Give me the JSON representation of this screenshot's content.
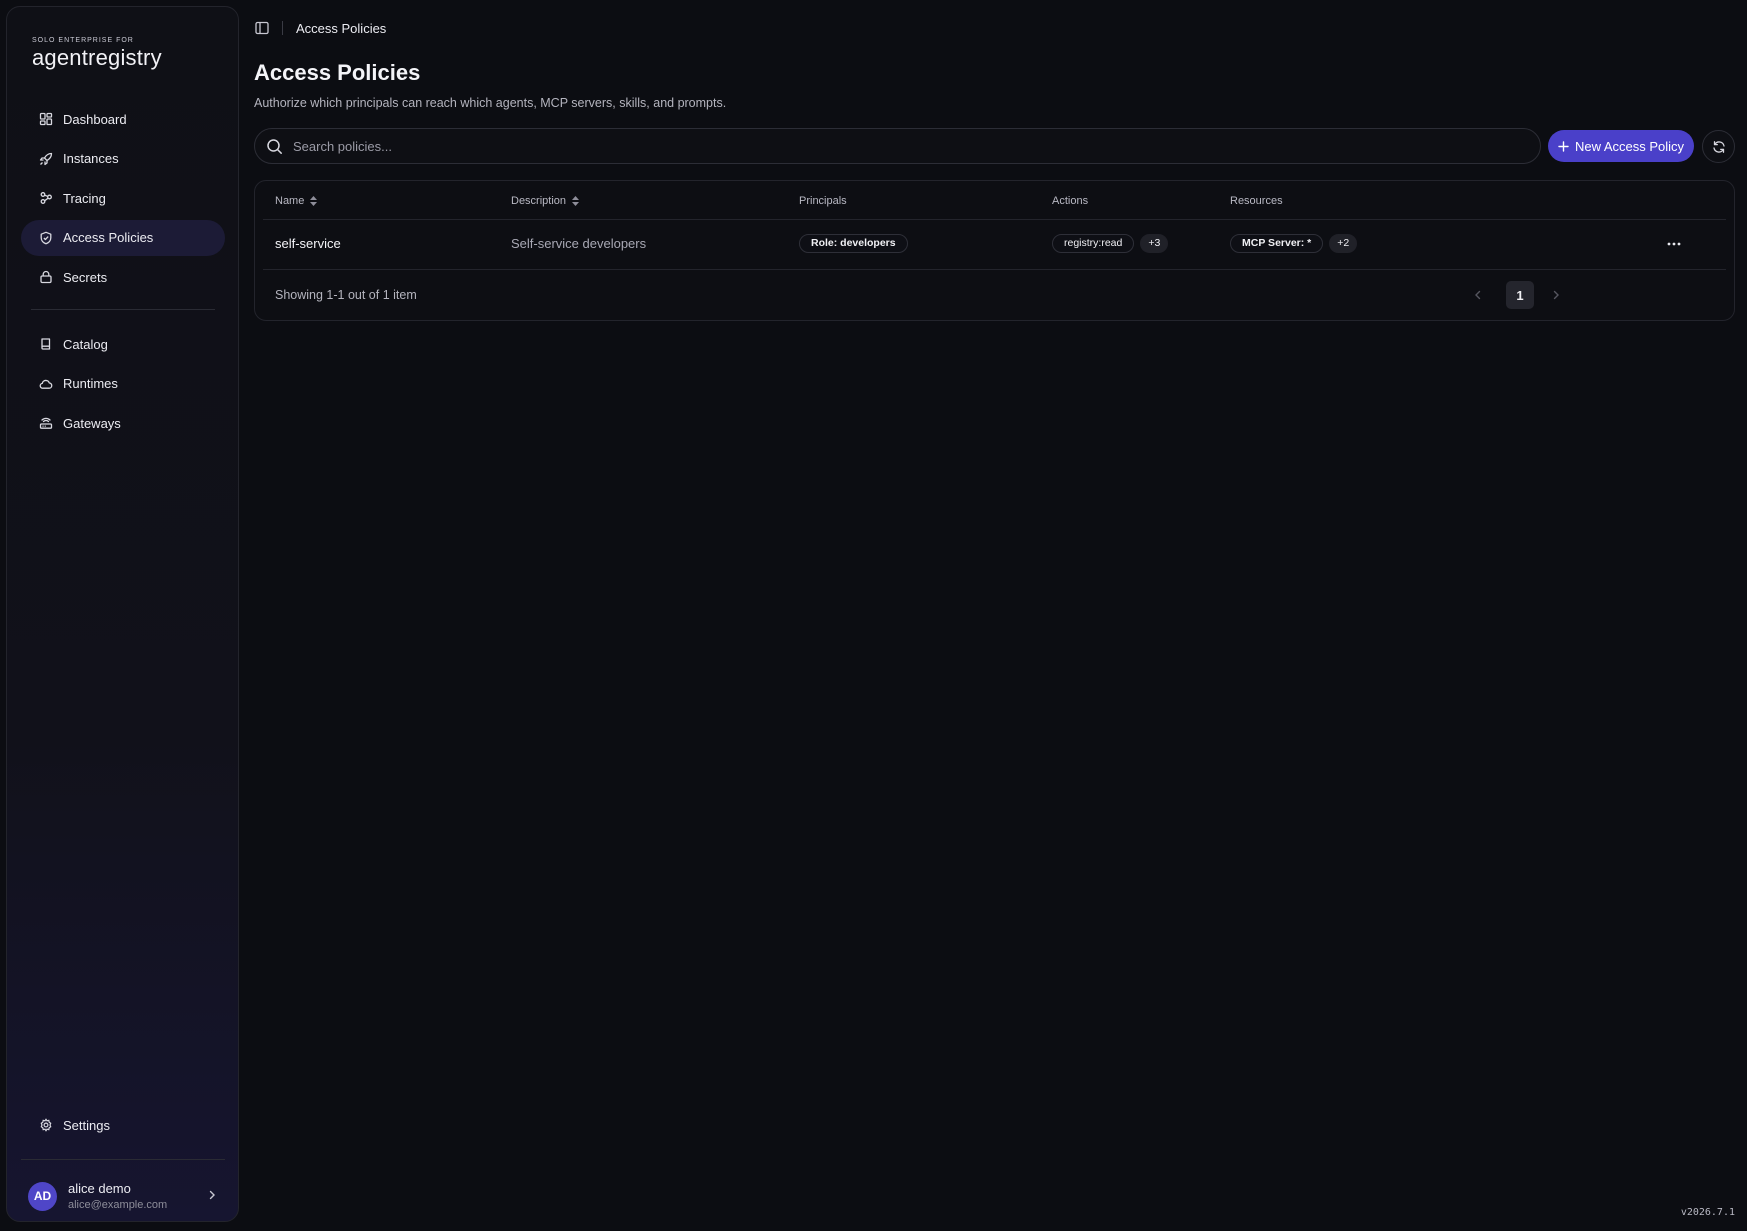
{
  "brand": {
    "small": "SOLO ENTERPRISE FOR",
    "name": "agentregistry"
  },
  "nav": {
    "primary": [
      {
        "label": "Dashboard",
        "icon": "grid-icon"
      },
      {
        "label": "Instances",
        "icon": "rocket-icon"
      },
      {
        "label": "Tracing",
        "icon": "nodes-icon"
      },
      {
        "label": "Access Policies",
        "icon": "shield-check-icon",
        "active": true
      },
      {
        "label": "Secrets",
        "icon": "lock-icon"
      }
    ],
    "secondary": [
      {
        "label": "Catalog",
        "icon": "book-icon"
      },
      {
        "label": "Runtimes",
        "icon": "cloud-icon"
      },
      {
        "label": "Gateways",
        "icon": "router-icon"
      }
    ],
    "settings": {
      "label": "Settings",
      "icon": "gear-icon"
    }
  },
  "user": {
    "initials": "AD",
    "name": "alice demo",
    "email": "alice@example.com"
  },
  "breadcrumb": {
    "current": "Access Policies"
  },
  "page": {
    "title": "Access Policies",
    "subtitle": "Authorize which principals can reach which agents, MCP servers, skills, and prompts."
  },
  "search": {
    "placeholder": "Search policies..."
  },
  "toolbar": {
    "new_label": "New Access Policy"
  },
  "table": {
    "columns": [
      "Name",
      "Description",
      "Principals",
      "Actions",
      "Resources"
    ],
    "rows": [
      {
        "name": "self-service",
        "description": "Self-service developers",
        "principal": "Role: developers",
        "action": "registry:read",
        "action_more": "+3",
        "resource": "MCP Server: *",
        "resource_more": "+2"
      }
    ]
  },
  "pagination": {
    "summary": "Showing 1-1 out of 1 item",
    "current_page": "1"
  },
  "version": "v2026.7.1",
  "colors": {
    "accent": "#4a40c9",
    "background": "#0c0d12",
    "active_nav": "#1c1b36"
  }
}
